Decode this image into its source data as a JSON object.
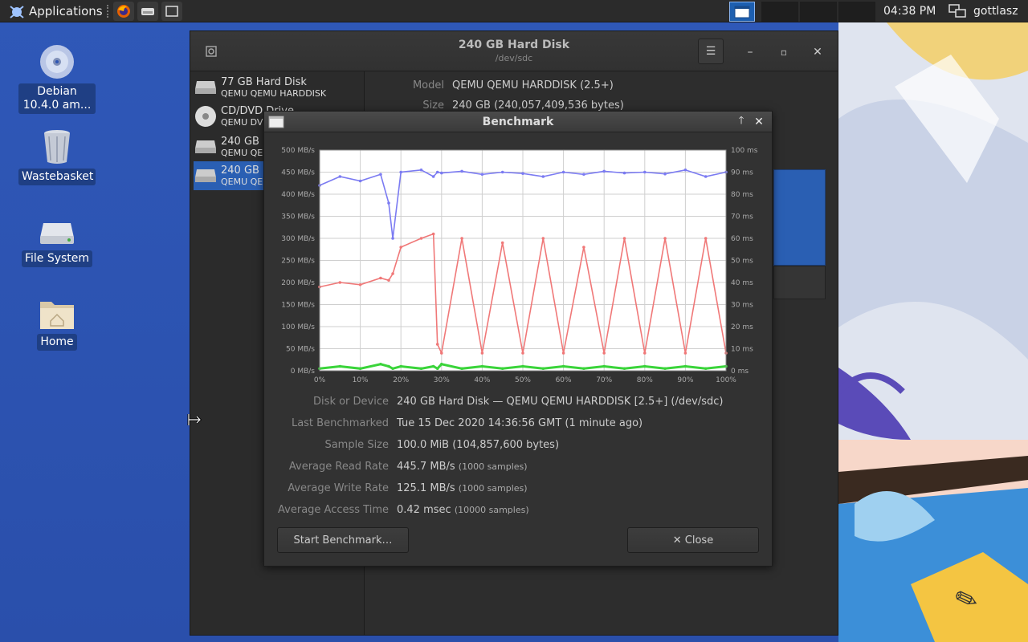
{
  "panel": {
    "apps_label": "Applications",
    "clock": "04:38 PM",
    "user": "gottlasz",
    "launchers": [
      "firefox-icon",
      "disks-icon",
      "window-icon"
    ]
  },
  "desktop": {
    "icons": [
      {
        "label": "Debian 10.4.0 am...",
        "icon": "cd-disc-icon"
      },
      {
        "label": "Wastebasket",
        "icon": "trash-icon"
      },
      {
        "label": "File System",
        "icon": "drive-icon"
      },
      {
        "label": "Home",
        "icon": "home-folder-icon"
      }
    ]
  },
  "disks_window": {
    "title": "240 GB Hard Disk",
    "subtitle": "/dev/sdc",
    "drives": [
      {
        "name": "77 GB Hard Disk",
        "sub": "QEMU QEMU HARDDISK"
      },
      {
        "name": "CD/DVD Drive",
        "sub": "QEMU DV"
      },
      {
        "name": "240 GB",
        "sub": "QEMU QE"
      },
      {
        "name": "240 GB",
        "sub": "QEMU QE"
      }
    ],
    "model_label": "Model",
    "model_value": "QEMU QEMU HARDDISK (2.5+)",
    "size_label": "Size",
    "size_value": "240 GB (240,057,409,536 bytes)"
  },
  "benchmark": {
    "title": "Benchmark",
    "info": [
      {
        "key": "Disk or Device",
        "value": "240 GB Hard Disk — QEMU QEMU HARDDISK [2.5+] (/dev/sdc)",
        "extra": ""
      },
      {
        "key": "Last Benchmarked",
        "value": "Tue 15 Dec 2020 14:36:56 GMT (1 minute ago)",
        "extra": ""
      },
      {
        "key": "Sample Size",
        "value": "100.0 MiB (104,857,600 bytes)",
        "extra": ""
      },
      {
        "key": "Average Read Rate",
        "value": "445.7 MB/s",
        "extra": "(1000 samples)"
      },
      {
        "key": "Average Write Rate",
        "value": "125.1 MB/s",
        "extra": "(1000 samples)"
      },
      {
        "key": "Average Access Time",
        "value": "0.42 msec",
        "extra": "(10000 samples)"
      }
    ],
    "start_label": "Start Benchmark…",
    "close_label": "✕ Close"
  },
  "chart_data": {
    "type": "line",
    "x": [
      0,
      5,
      10,
      15,
      17,
      18,
      20,
      25,
      28,
      29,
      30,
      35,
      40,
      45,
      50,
      55,
      60,
      65,
      70,
      75,
      80,
      85,
      90,
      95,
      100
    ],
    "series": [
      {
        "name": "",
        "color": "#7b7bf2",
        "axis": "left",
        "values": [
          420,
          440,
          430,
          445,
          380,
          300,
          450,
          455,
          440,
          450,
          448,
          452,
          445,
          450,
          447,
          440,
          450,
          445,
          452,
          448,
          450,
          446,
          455,
          440,
          450
        ]
      },
      {
        "name": "",
        "color": "#f07878",
        "axis": "left",
        "values": [
          190,
          200,
          195,
          210,
          205,
          220,
          280,
          300,
          310,
          60,
          40,
          300,
          40,
          290,
          40,
          300,
          40,
          280,
          40,
          300,
          40,
          300,
          40,
          300,
          40
        ]
      },
      {
        "name": "",
        "color": "#3ad43a",
        "axis": "right",
        "values": [
          1,
          2,
          1,
          3,
          2,
          1,
          2,
          1,
          2,
          1,
          3,
          1,
          2,
          1,
          2,
          1,
          2,
          1,
          2,
          1,
          2,
          1,
          2,
          1,
          2
        ]
      }
    ],
    "xlim": [
      0,
      100
    ],
    "ylim": [
      0,
      500
    ],
    "y2lim": [
      0,
      100
    ],
    "x_ticks": [
      "0%",
      "10%",
      "20%",
      "30%",
      "40%",
      "50%",
      "60%",
      "70%",
      "80%",
      "90%",
      "100%"
    ],
    "y_ticks": [
      "0 MB/s",
      "50 MB/s",
      "100 MB/s",
      "150 MB/s",
      "200 MB/s",
      "250 MB/s",
      "300 MB/s",
      "350 MB/s",
      "400 MB/s",
      "450 MB/s",
      "500 MB/s"
    ],
    "y2_ticks": [
      "0 ms",
      "10 ms",
      "20 ms",
      "30 ms",
      "40 ms",
      "50 ms",
      "60 ms",
      "70 ms",
      "80 ms",
      "90 ms",
      "100 ms"
    ],
    "grid": true
  }
}
